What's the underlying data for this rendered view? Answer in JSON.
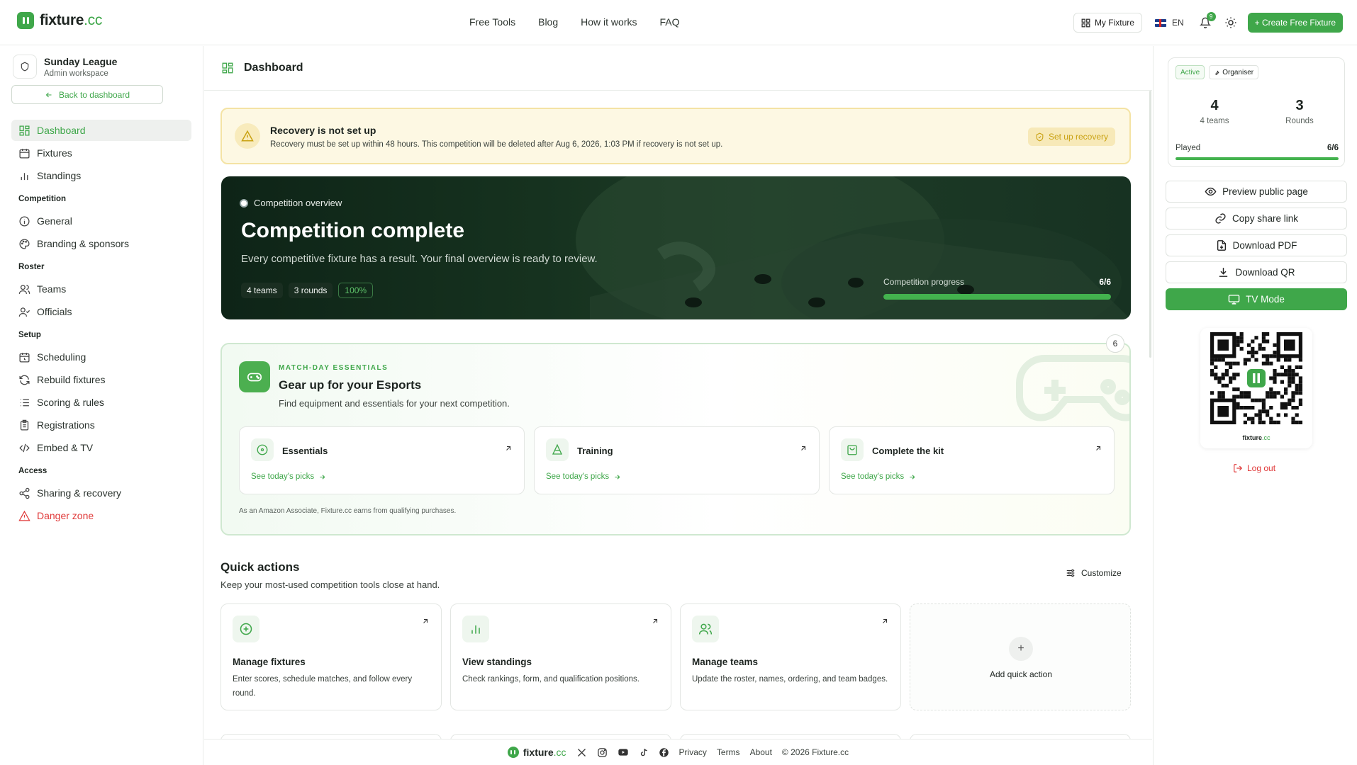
{
  "brand": {
    "name": "fixture",
    "tld": ".cc",
    "accent": "#3fa74a"
  },
  "nav": [
    "Free Tools",
    "Blog",
    "How it works",
    "FAQ"
  ],
  "header": {
    "my_fixture": "My Fixture",
    "lang": "EN",
    "notifications": "9",
    "create": "+ Create Free Fixture"
  },
  "sidebar": {
    "org_name": "Sunday League",
    "org_sub": "Admin workspace",
    "back": "Back to dashboard",
    "items": [
      {
        "label": "Dashboard",
        "icon": "grid-icon"
      },
      {
        "label": "Fixtures",
        "icon": "calendar-icon"
      },
      {
        "label": "Standings",
        "icon": "bar-chart-icon"
      },
      {
        "section": "Competition"
      },
      {
        "label": "General",
        "icon": "info-icon"
      },
      {
        "label": "Branding & sponsors",
        "icon": "palette-icon"
      },
      {
        "section": "Roster"
      },
      {
        "label": "Teams",
        "icon": "users-icon"
      },
      {
        "label": "Officials",
        "icon": "user-check-icon"
      },
      {
        "section": "Setup"
      },
      {
        "label": "Scheduling",
        "icon": "calendar-clock-icon"
      },
      {
        "label": "Rebuild fixtures",
        "icon": "refresh-icon"
      },
      {
        "label": "Scoring & rules",
        "icon": "list-icon"
      },
      {
        "label": "Registrations",
        "icon": "clipboard-icon"
      },
      {
        "label": "Embed & TV",
        "icon": "code-icon"
      },
      {
        "section": "Access"
      },
      {
        "label": "Sharing & recovery",
        "icon": "share-icon"
      },
      {
        "label": "Danger zone",
        "icon": "warning-icon"
      }
    ]
  },
  "page": {
    "title": "Dashboard"
  },
  "alert": {
    "title": "Recovery is not set up",
    "desc": "Recovery must be set up within 48 hours. This competition will be deleted after Aug 6, 2026, 1:03 PM if recovery is not set up.",
    "button": "Set up recovery"
  },
  "hero": {
    "kicker": "Competition overview",
    "title": "Competition complete",
    "desc": "Every competitive fixture has a result. Your final overview is ready to review.",
    "chips": [
      "4 teams",
      "3 rounds",
      "100%"
    ],
    "progress_label": "Competition progress",
    "progress_value": "6/6",
    "progress_fraction": 1.0
  },
  "essentials": {
    "count": "6",
    "kicker": "MATCH-DAY ESSENTIALS",
    "title": "Gear up for your Esports",
    "desc": "Find equipment and essentials for your next competition.",
    "cards": [
      {
        "title": "Essentials",
        "link": "See today's picks"
      },
      {
        "title": "Training",
        "link": "See today's picks"
      },
      {
        "title": "Complete the kit",
        "link": "See today's picks"
      }
    ],
    "note": "As an Amazon Associate, Fixture.cc earns from qualifying purchases."
  },
  "quick": {
    "title": "Quick actions",
    "sub": "Keep your most-used competition tools close at hand.",
    "customize": "Customize",
    "cards": [
      {
        "title": "Manage fixtures",
        "desc": "Enter scores, schedule matches, and follow every round."
      },
      {
        "title": "View standings",
        "desc": "Check rankings, form, and qualification positions."
      },
      {
        "title": "Manage teams",
        "desc": "Update the roster, names, ordering, and team badges."
      }
    ],
    "add": "Add quick action"
  },
  "footer": {
    "links": [
      "Privacy",
      "Terms",
      "About"
    ],
    "copyright": "© 2026 Fixture.cc"
  },
  "right": {
    "badge_active": "Active",
    "badge_role": "Organiser",
    "stat1_value": "4",
    "stat1_label": "4 teams",
    "stat2_value": "3",
    "stat2_label": "Rounds",
    "played_label": "Played",
    "played_value": "6/6",
    "played_fraction": 1.0,
    "buttons": [
      "Preview public page",
      "Copy share link",
      "Download PDF",
      "Download QR",
      "TV Mode"
    ],
    "logout": "Log out"
  }
}
